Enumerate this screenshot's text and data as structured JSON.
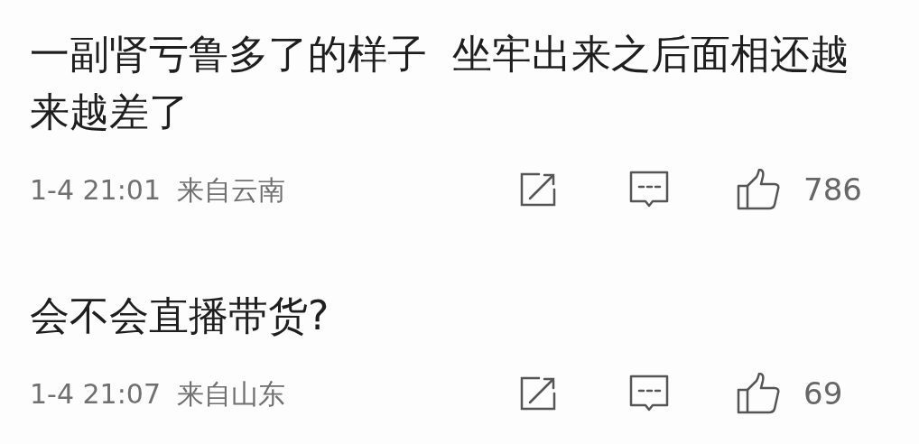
{
  "comments": [
    {
      "text": "一副肾亏鲁多了的样子  坐牢出来之后面相还越来越差了",
      "time": "1-4 21:01",
      "location": "来自云南",
      "likes": "786"
    },
    {
      "text": "会不会直播带货?",
      "time": "1-4 21:07",
      "location": "来自山东",
      "likes": "69"
    }
  ]
}
